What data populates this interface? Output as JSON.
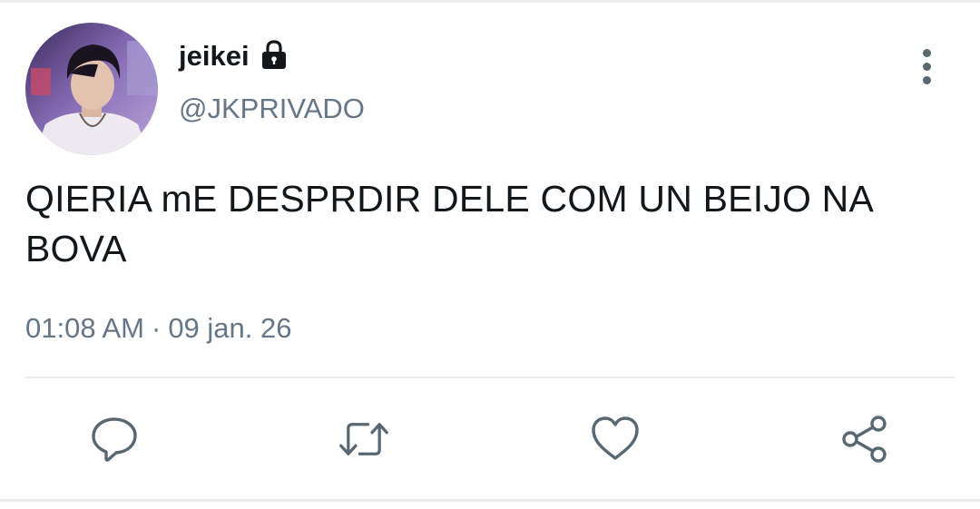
{
  "tweet": {
    "author": {
      "display_name": "jeikei",
      "handle": "@JKPRIVADO",
      "protected": true,
      "avatar_icon": "avatar-photo",
      "lock_icon": "lock-icon"
    },
    "text": "QIERIA mE DESPRDIR DELE COM UN BEIJO NA BOVA",
    "time": "01:08 AM",
    "separator": "·",
    "date": "09 jan. 26",
    "more_icon": "more-vertical-icon"
  },
  "actions": [
    {
      "name": "reply",
      "icon": "reply-icon"
    },
    {
      "name": "retweet",
      "icon": "retweet-icon"
    },
    {
      "name": "like",
      "icon": "heart-icon"
    },
    {
      "name": "share",
      "icon": "share-icon"
    }
  ],
  "colors": {
    "text_primary": "#14171a",
    "text_secondary": "#657786",
    "icon": "#586873",
    "divider": "#e6ecf0"
  }
}
